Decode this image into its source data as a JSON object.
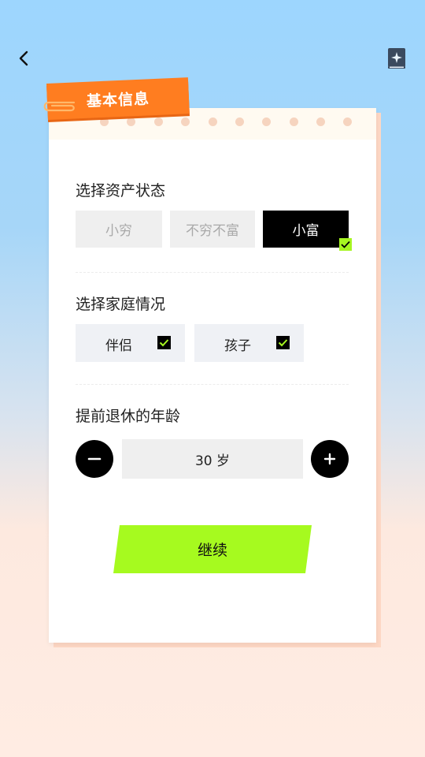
{
  "nav": {
    "back_icon": "chevron-left-icon",
    "book_icon": "sparkle-book-icon"
  },
  "tag": {
    "title": "基本信息"
  },
  "asset": {
    "title": "选择资产状态",
    "options": [
      {
        "label": "小穷",
        "selected": false
      },
      {
        "label": "不穷不富",
        "selected": false
      },
      {
        "label": "小富",
        "selected": true
      }
    ]
  },
  "family": {
    "title": "选择家庭情况",
    "options": [
      {
        "label": "伴侣",
        "checked": true
      },
      {
        "label": "孩子",
        "checked": true
      }
    ]
  },
  "retire": {
    "title": "提前退休的年龄",
    "value": "30 岁"
  },
  "actions": {
    "continue_label": "继续"
  },
  "colors": {
    "accent": "#a6fa1f",
    "tag": "#ff7d20",
    "selected": "#000000"
  }
}
